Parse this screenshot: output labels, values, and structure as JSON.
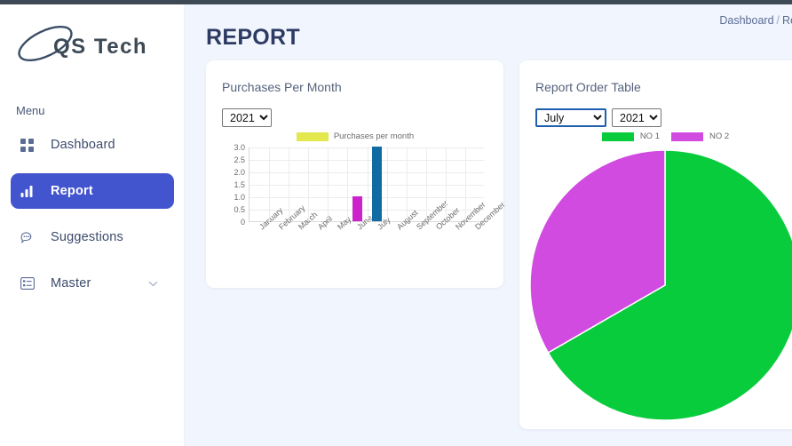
{
  "brand": {
    "name": "QS Tech",
    "logo_icon": "ellipse-q-logo"
  },
  "sidebar": {
    "section_label": "Menu",
    "items": [
      {
        "label": "Dashboard",
        "icon": "grid-icon",
        "active": false
      },
      {
        "label": "Report",
        "icon": "bar-chart-icon",
        "active": true
      },
      {
        "label": "Suggestions",
        "icon": "chat-bubble-icon",
        "active": false
      },
      {
        "label": "Master",
        "icon": "list-icon",
        "active": false,
        "chevron": "chevron-down-icon"
      }
    ]
  },
  "header": {
    "title": "REPORT",
    "breadcrumb": {
      "root": "Dashboard",
      "separator": "/",
      "current": "Re"
    }
  },
  "colors": {
    "accent": "#4355ce",
    "page_bg": "#f1f5fd",
    "topbar": "#3d4a56",
    "bar_blue": "#0f6ba2",
    "bar_magenta": "#cc22cc",
    "legend_yellow": "#e2e84e",
    "pie_green": "#09cc3d",
    "pie_magenta": "#d14be0"
  },
  "bar_card": {
    "title": "Purchases Per Month",
    "year_select": {
      "value": "2021",
      "options": [
        "2021"
      ]
    }
  },
  "pie_card": {
    "title": "Report Order Table",
    "month_select": {
      "value": "July",
      "options": [
        "July"
      ],
      "focused": true
    },
    "year_select": {
      "value": "2021",
      "options": [
        "2021"
      ]
    }
  },
  "chart_data": [
    {
      "type": "bar",
      "title": "",
      "legend": [
        "Purchases per month"
      ],
      "legend_position": "top-center",
      "categories": [
        "January",
        "February",
        "March",
        "April",
        "May",
        "June",
        "July",
        "August",
        "September",
        "October",
        "November",
        "December"
      ],
      "values": [
        0,
        0,
        0,
        0,
        0,
        1,
        3,
        0,
        0,
        0,
        0,
        0
      ],
      "bar_colors": [
        "",
        "",
        "",
        "",
        "",
        "#cc22cc",
        "#0f6ba2",
        "",
        "",
        "",
        "",
        ""
      ],
      "yticks": [
        "0",
        "0.5",
        "1.0",
        "1.5",
        "2.0",
        "2.5",
        "3.0"
      ],
      "ylim": [
        0,
        3
      ],
      "xlabel": "",
      "ylabel": "",
      "grid": true
    },
    {
      "type": "pie",
      "title": "",
      "labels": [
        "NO 1",
        "NO 2"
      ],
      "values": [
        2,
        1
      ],
      "percentages": [
        66.7,
        33.3
      ],
      "colors": [
        "#09cc3d",
        "#d14be0"
      ],
      "legend_position": "top-center",
      "start_angle_deg": 0
    }
  ]
}
